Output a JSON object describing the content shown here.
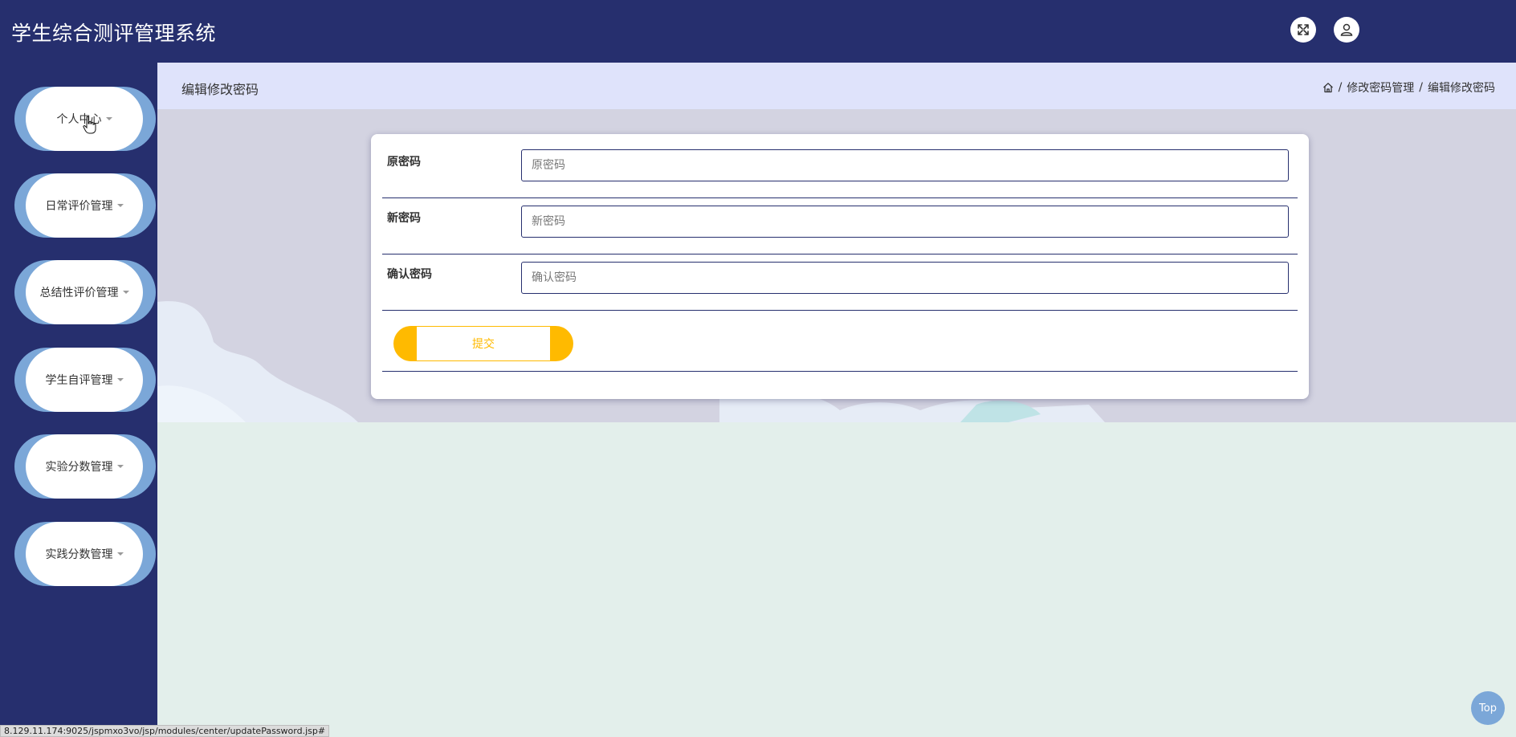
{
  "header": {
    "app_title": "学生综合测评管理系统",
    "fullscreen_icon": "fullscreen-icon",
    "user_icon": "user-icon"
  },
  "sidebar": {
    "items": [
      {
        "label": "个人中心"
      },
      {
        "label": "日常评价管理"
      },
      {
        "label": "总结性评价管理"
      },
      {
        "label": "学生自评管理"
      },
      {
        "label": "实验分数管理"
      },
      {
        "label": "实践分数管理"
      }
    ]
  },
  "breadcrumbbar": {
    "page_title": "编辑修改密码",
    "home_icon": "home-icon",
    "crumbs": [
      "修改密码管理",
      "编辑修改密码"
    ],
    "separator": "/"
  },
  "form": {
    "fields": [
      {
        "label": "原密码",
        "placeholder": "原密码",
        "value": ""
      },
      {
        "label": "新密码",
        "placeholder": "新密码",
        "value": ""
      },
      {
        "label": "确认密码",
        "placeholder": "确认密码",
        "value": ""
      }
    ],
    "submit_label": "提交"
  },
  "status_url": "8.129.11.174:9025/jspmxo3vo/jsp/modules/center/updatePassword.jsp#",
  "top_button_label": "Top",
  "colors": {
    "header_bg": "#262f6e",
    "breadcrumb_bg": "#dfe3fb",
    "accent_yellow": "#ffba00",
    "menu_pill_blue": "#7ba7d8",
    "content_bg": "#e3efeb"
  }
}
